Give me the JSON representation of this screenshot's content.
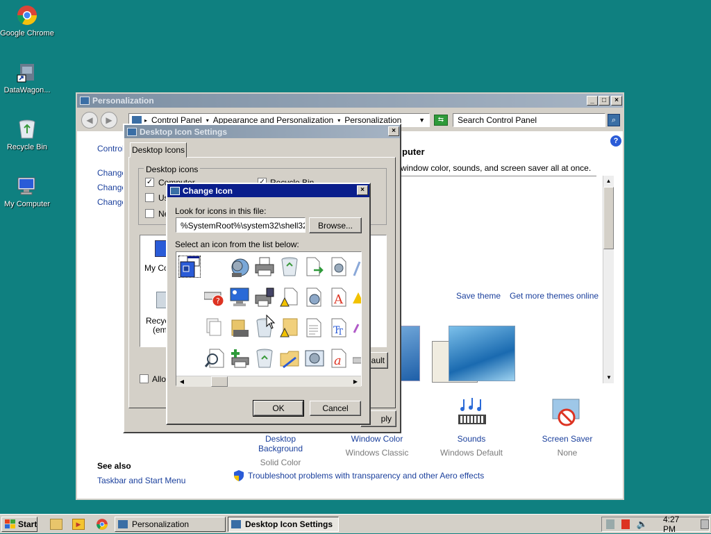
{
  "desktop": {
    "icons": [
      {
        "label": "Google Chrome",
        "icon": "chrome-icon"
      },
      {
        "label": "DataWagon...",
        "icon": "shortcut-icon"
      },
      {
        "label": "Recycle Bin",
        "icon": "recycle-bin-icon"
      },
      {
        "label": "My Computer",
        "icon": "computer-icon"
      }
    ]
  },
  "personalization": {
    "title": "Personalization",
    "breadcrumb": [
      "Control Panel",
      "Appearance and Personalization",
      "Personalization"
    ],
    "search_placeholder": "Search Control Panel",
    "left_links": [
      "Control",
      "Change",
      "Change",
      "Change"
    ],
    "heading": "puter",
    "description": "window color, sounds, and screen saver all at once.",
    "save_theme": "Save theme",
    "get_more_themes": "Get more themes online",
    "items": [
      {
        "label": "Desktop Background",
        "sub": "Solid Color"
      },
      {
        "label": "Window Color",
        "sub": "Windows Classic"
      },
      {
        "label": "Sounds",
        "sub": "Windows Default"
      },
      {
        "label": "Screen Saver",
        "sub": "None"
      }
    ],
    "see_also": "See also",
    "taskbar_link": "Taskbar and Start Menu",
    "troubleshoot": "Troubleshoot problems with transparency and other Aero effects"
  },
  "desktop_icon_settings": {
    "title": "Desktop Icon Settings",
    "tab": "Desktop Icons",
    "group": "Desktop icons",
    "checkboxes": [
      {
        "label": "Computer",
        "checked": true
      },
      {
        "label": "Recycle Bin",
        "checked": true
      },
      {
        "label": "Us",
        "checked": false
      },
      {
        "label": "Ne",
        "checked": false
      }
    ],
    "preview_labels": [
      "My Co",
      "Recyc",
      "(emp"
    ],
    "allow_label": "Allov",
    "restore_partial": "ault",
    "apply_partial": "ply"
  },
  "change_icon": {
    "title": "Change Icon",
    "look_label": "Look for icons in this file:",
    "file_path": "%SystemRoot%\\system32\\shell32.d",
    "browse": "Browse...",
    "select_label": "Select an icon from the list below:",
    "ok": "OK",
    "cancel": "Cancel"
  },
  "taskbar": {
    "start": "Start",
    "tasks": [
      "Personalization",
      "Desktop Icon Settings"
    ],
    "time": "4:27 PM"
  },
  "colors": {
    "desktop": "#0f8080",
    "title_active": "#0a1e8c",
    "link": "#1a3f9c"
  }
}
